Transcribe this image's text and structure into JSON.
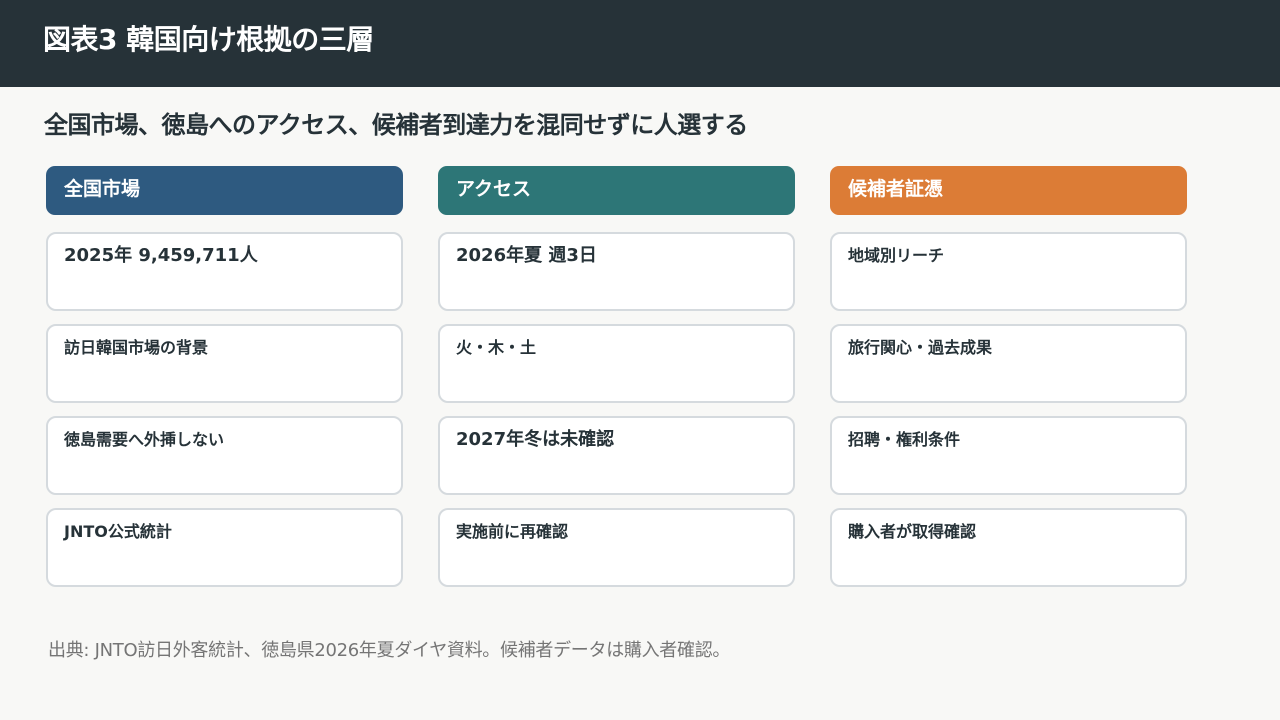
{
  "header": {
    "title": "図表3 韓国向け根拠の三層"
  },
  "subtitle": "全国市場、徳島へのアクセス、候補者到達力を混同せずに人選する",
  "columns": [
    {
      "heading": "全国市場",
      "color": "#2e5a80",
      "cards": [
        "2025年 9,459,711人",
        "訪日韓国市場の背景",
        "徳島需要へ外挿しない",
        "JNTO公式統計"
      ]
    },
    {
      "heading": "アクセス",
      "color": "#2d7677",
      "cards": [
        "2026年夏 週3日",
        "火・木・土",
        "2027年冬は未確認",
        "実施前に再確認"
      ]
    },
    {
      "heading": "候補者証憑",
      "color": "#dc7c36",
      "cards": [
        "地域別リーチ",
        "旅行関心・過去成果",
        "招聘・権利条件",
        "購入者が取得確認"
      ]
    }
  ],
  "footnote": "出典: JNTO訪日外客統計、徳島県2026年夏ダイヤ資料。候補者データは購入者確認。"
}
